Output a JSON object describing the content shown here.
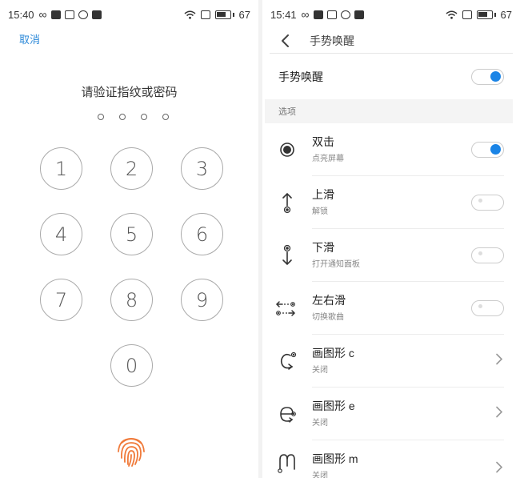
{
  "left": {
    "status": {
      "time": "15:40",
      "battery": "67"
    },
    "cancel": "取消",
    "prompt": "请验证指纹或密码",
    "keys": [
      "1",
      "2",
      "3",
      "4",
      "5",
      "6",
      "7",
      "8",
      "9",
      "0"
    ]
  },
  "right": {
    "status": {
      "time": "15:41",
      "battery": "67"
    },
    "header_title": "手势唤醒",
    "main_toggle": {
      "label": "手势唤醒",
      "on": true
    },
    "section": "选项",
    "items": [
      {
        "title": "双击",
        "subtitle": "点亮屏幕",
        "control": "toggle",
        "on": true,
        "icon": "double-tap-icon"
      },
      {
        "title": "上滑",
        "subtitle": "解锁",
        "control": "toggle",
        "on": false,
        "icon": "swipe-up-icon"
      },
      {
        "title": "下滑",
        "subtitle": "打开通知面板",
        "control": "toggle",
        "on": false,
        "icon": "swipe-down-icon"
      },
      {
        "title": "左右滑",
        "subtitle": "切换歌曲",
        "control": "toggle",
        "on": false,
        "icon": "swipe-left-right-icon"
      },
      {
        "title": "画图形 c",
        "subtitle": "关闭",
        "control": "chevron",
        "icon": "draw-c-icon"
      },
      {
        "title": "画图形 e",
        "subtitle": "关闭",
        "control": "chevron",
        "icon": "draw-e-icon"
      },
      {
        "title": "画图形 m",
        "subtitle": "关闭",
        "control": "chevron",
        "icon": "draw-m-icon"
      }
    ]
  },
  "colors": {
    "accent": "#1a84e6",
    "link": "#2b88d8",
    "fingerprint": "#f07a3a"
  }
}
